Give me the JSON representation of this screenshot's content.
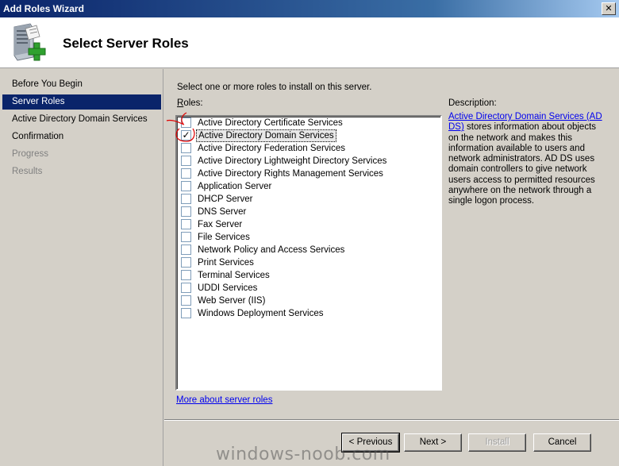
{
  "window": {
    "title": "Add Roles Wizard",
    "close_glyph": "✕"
  },
  "header": {
    "title": "Select Server Roles",
    "icon": "server-add-icon"
  },
  "sidebar": {
    "items": [
      {
        "label": "Before You Begin",
        "state": "normal"
      },
      {
        "label": "Server Roles",
        "state": "selected"
      },
      {
        "label": "Active Directory Domain Services",
        "state": "bold"
      },
      {
        "label": "Confirmation",
        "state": "bold"
      },
      {
        "label": "Progress",
        "state": "disabled"
      },
      {
        "label": "Results",
        "state": "disabled"
      }
    ]
  },
  "main": {
    "instruction": "Select one or more roles to install on this server.",
    "roles_label_accel": "R",
    "roles_label_rest": "oles:",
    "roles": [
      {
        "label": "Active Directory Certificate Services",
        "checked": false
      },
      {
        "label": "Active Directory Domain Services",
        "checked": true
      },
      {
        "label": "Active Directory Federation Services",
        "checked": false
      },
      {
        "label": "Active Directory Lightweight Directory Services",
        "checked": false
      },
      {
        "label": "Active Directory Rights Management Services",
        "checked": false
      },
      {
        "label": "Application Server",
        "checked": false
      },
      {
        "label": "DHCP Server",
        "checked": false
      },
      {
        "label": "DNS Server",
        "checked": false
      },
      {
        "label": "Fax Server",
        "checked": false
      },
      {
        "label": "File Services",
        "checked": false
      },
      {
        "label": "Network Policy and Access Services",
        "checked": false
      },
      {
        "label": "Print Services",
        "checked": false
      },
      {
        "label": "Terminal Services",
        "checked": false
      },
      {
        "label": "UDDI Services",
        "checked": false
      },
      {
        "label": "Web Server (IIS)",
        "checked": false
      },
      {
        "label": "Windows Deployment Services",
        "checked": false
      }
    ],
    "description_label": "Description:",
    "description_link": "Active Directory Domain Services (AD DS)",
    "description_body": " stores information about objects on the network and makes this information available to users and network administrators. AD DS uses domain controllers to give network users access to permitted resources anywhere on the network through a single logon process.",
    "more_link": "More about server roles"
  },
  "buttons": {
    "previous": "< Previous",
    "next": "Next >",
    "install": "Install",
    "cancel": "Cancel"
  },
  "watermark": "windows-noob.com",
  "colors": {
    "selection": "#0a246a",
    "link": "#0000ee",
    "annotation": "#e00000"
  }
}
